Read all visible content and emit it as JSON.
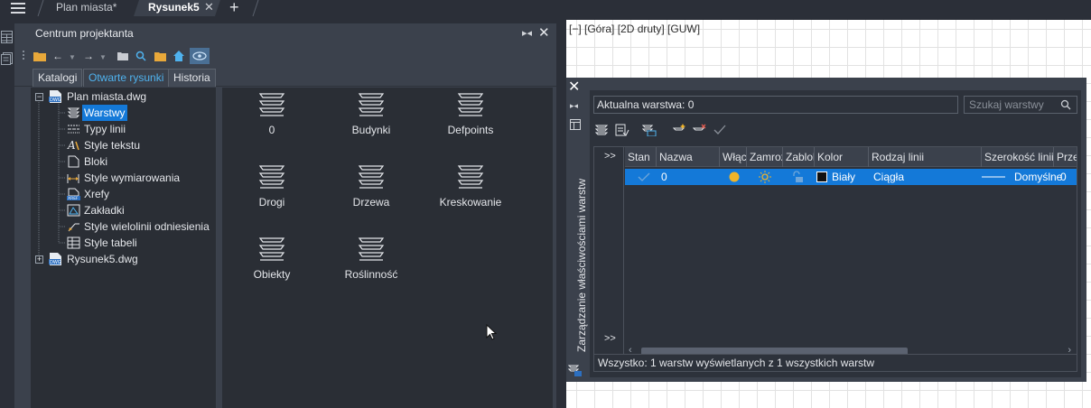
{
  "top_tabs": {
    "menu_icon": "hamburger-icon",
    "tabs": [
      {
        "label": "Plan miasta*"
      },
      {
        "label": "Rysunek5"
      }
    ],
    "close_glyph": "✕",
    "add_glyph": "+"
  },
  "design_center": {
    "title": "Centrum projektanta",
    "tabs": [
      "Katalogi",
      "Otwarte rysunki",
      "Historia"
    ],
    "tree": {
      "root1": "Plan miasta.dwg",
      "items": [
        "Warstwy",
        "Typy linii",
        "Style tekstu",
        "Bloki",
        "Style wymiarowania",
        "Xrefy",
        "Zakładki",
        "Style wielolinii odniesienia",
        "Style tabeli"
      ],
      "root2": "Rysunek5.dwg"
    },
    "layers": [
      "0",
      "Budynki",
      "Defpoints",
      "Drogi",
      "Drzewa",
      "Kreskowanie",
      "Obiekty",
      "Roślinność"
    ]
  },
  "viewport": {
    "label": "[−] [Góra] [2D druty] [GUW]"
  },
  "layer_manager": {
    "side_title": "Zarządzanie właściwościami warstw",
    "current_layer": "Aktualna warstwa: 0",
    "search_placeholder": "Szukaj warstwy",
    "chevron": ">>",
    "columns": [
      "Stan",
      "Nazwa",
      "Włąc",
      "Zamroź",
      "Zablok",
      "Kolor",
      "Rodzaj linii",
      "Szerokość linii",
      "Prze"
    ],
    "row": {
      "name": "0",
      "color_name": "Biały",
      "color_swatch": "#111111",
      "on_color": "#f0b429",
      "linetype": "Ciągła",
      "lineweight": "Domyślne",
      "transparency": "0"
    },
    "status": "Wszystko: 1 warstw wyświetlanych z 1 wszystkich warstw"
  }
}
